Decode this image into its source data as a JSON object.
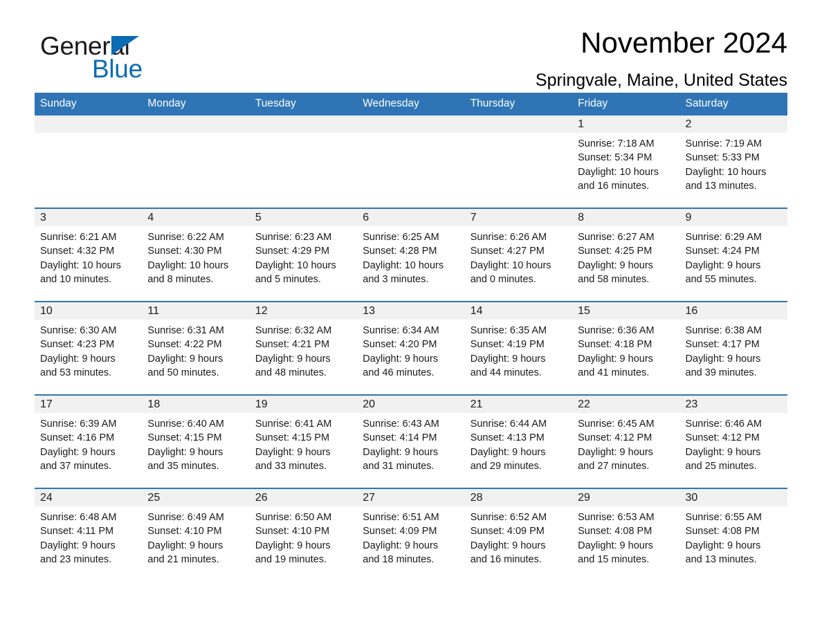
{
  "brand": {
    "name_part1": "General",
    "name_part2": "Blue",
    "flag_icon": "triangle-flag-icon",
    "accent_color": "#0b6cb4"
  },
  "header": {
    "month_title": "November 2024",
    "location": "Springvale, Maine, United States"
  },
  "calendar": {
    "header_color": "#2f75b5",
    "weekdays": [
      "Sunday",
      "Monday",
      "Tuesday",
      "Wednesday",
      "Thursday",
      "Friday",
      "Saturday"
    ],
    "weeks": [
      [
        {
          "day": "",
          "sunrise": "",
          "sunset": "",
          "daylight1": "",
          "daylight2": ""
        },
        {
          "day": "",
          "sunrise": "",
          "sunset": "",
          "daylight1": "",
          "daylight2": ""
        },
        {
          "day": "",
          "sunrise": "",
          "sunset": "",
          "daylight1": "",
          "daylight2": ""
        },
        {
          "day": "",
          "sunrise": "",
          "sunset": "",
          "daylight1": "",
          "daylight2": ""
        },
        {
          "day": "",
          "sunrise": "",
          "sunset": "",
          "daylight1": "",
          "daylight2": ""
        },
        {
          "day": "1",
          "sunrise": "Sunrise: 7:18 AM",
          "sunset": "Sunset: 5:34 PM",
          "daylight1": "Daylight: 10 hours",
          "daylight2": "and 16 minutes."
        },
        {
          "day": "2",
          "sunrise": "Sunrise: 7:19 AM",
          "sunset": "Sunset: 5:33 PM",
          "daylight1": "Daylight: 10 hours",
          "daylight2": "and 13 minutes."
        }
      ],
      [
        {
          "day": "3",
          "sunrise": "Sunrise: 6:21 AM",
          "sunset": "Sunset: 4:32 PM",
          "daylight1": "Daylight: 10 hours",
          "daylight2": "and 10 minutes."
        },
        {
          "day": "4",
          "sunrise": "Sunrise: 6:22 AM",
          "sunset": "Sunset: 4:30 PM",
          "daylight1": "Daylight: 10 hours",
          "daylight2": "and 8 minutes."
        },
        {
          "day": "5",
          "sunrise": "Sunrise: 6:23 AM",
          "sunset": "Sunset: 4:29 PM",
          "daylight1": "Daylight: 10 hours",
          "daylight2": "and 5 minutes."
        },
        {
          "day": "6",
          "sunrise": "Sunrise: 6:25 AM",
          "sunset": "Sunset: 4:28 PM",
          "daylight1": "Daylight: 10 hours",
          "daylight2": "and 3 minutes."
        },
        {
          "day": "7",
          "sunrise": "Sunrise: 6:26 AM",
          "sunset": "Sunset: 4:27 PM",
          "daylight1": "Daylight: 10 hours",
          "daylight2": "and 0 minutes."
        },
        {
          "day": "8",
          "sunrise": "Sunrise: 6:27 AM",
          "sunset": "Sunset: 4:25 PM",
          "daylight1": "Daylight: 9 hours",
          "daylight2": "and 58 minutes."
        },
        {
          "day": "9",
          "sunrise": "Sunrise: 6:29 AM",
          "sunset": "Sunset: 4:24 PM",
          "daylight1": "Daylight: 9 hours",
          "daylight2": "and 55 minutes."
        }
      ],
      [
        {
          "day": "10",
          "sunrise": "Sunrise: 6:30 AM",
          "sunset": "Sunset: 4:23 PM",
          "daylight1": "Daylight: 9 hours",
          "daylight2": "and 53 minutes."
        },
        {
          "day": "11",
          "sunrise": "Sunrise: 6:31 AM",
          "sunset": "Sunset: 4:22 PM",
          "daylight1": "Daylight: 9 hours",
          "daylight2": "and 50 minutes."
        },
        {
          "day": "12",
          "sunrise": "Sunrise: 6:32 AM",
          "sunset": "Sunset: 4:21 PM",
          "daylight1": "Daylight: 9 hours",
          "daylight2": "and 48 minutes."
        },
        {
          "day": "13",
          "sunrise": "Sunrise: 6:34 AM",
          "sunset": "Sunset: 4:20 PM",
          "daylight1": "Daylight: 9 hours",
          "daylight2": "and 46 minutes."
        },
        {
          "day": "14",
          "sunrise": "Sunrise: 6:35 AM",
          "sunset": "Sunset: 4:19 PM",
          "daylight1": "Daylight: 9 hours",
          "daylight2": "and 44 minutes."
        },
        {
          "day": "15",
          "sunrise": "Sunrise: 6:36 AM",
          "sunset": "Sunset: 4:18 PM",
          "daylight1": "Daylight: 9 hours",
          "daylight2": "and 41 minutes."
        },
        {
          "day": "16",
          "sunrise": "Sunrise: 6:38 AM",
          "sunset": "Sunset: 4:17 PM",
          "daylight1": "Daylight: 9 hours",
          "daylight2": "and 39 minutes."
        }
      ],
      [
        {
          "day": "17",
          "sunrise": "Sunrise: 6:39 AM",
          "sunset": "Sunset: 4:16 PM",
          "daylight1": "Daylight: 9 hours",
          "daylight2": "and 37 minutes."
        },
        {
          "day": "18",
          "sunrise": "Sunrise: 6:40 AM",
          "sunset": "Sunset: 4:15 PM",
          "daylight1": "Daylight: 9 hours",
          "daylight2": "and 35 minutes."
        },
        {
          "day": "19",
          "sunrise": "Sunrise: 6:41 AM",
          "sunset": "Sunset: 4:15 PM",
          "daylight1": "Daylight: 9 hours",
          "daylight2": "and 33 minutes."
        },
        {
          "day": "20",
          "sunrise": "Sunrise: 6:43 AM",
          "sunset": "Sunset: 4:14 PM",
          "daylight1": "Daylight: 9 hours",
          "daylight2": "and 31 minutes."
        },
        {
          "day": "21",
          "sunrise": "Sunrise: 6:44 AM",
          "sunset": "Sunset: 4:13 PM",
          "daylight1": "Daylight: 9 hours",
          "daylight2": "and 29 minutes."
        },
        {
          "day": "22",
          "sunrise": "Sunrise: 6:45 AM",
          "sunset": "Sunset: 4:12 PM",
          "daylight1": "Daylight: 9 hours",
          "daylight2": "and 27 minutes."
        },
        {
          "day": "23",
          "sunrise": "Sunrise: 6:46 AM",
          "sunset": "Sunset: 4:12 PM",
          "daylight1": "Daylight: 9 hours",
          "daylight2": "and 25 minutes."
        }
      ],
      [
        {
          "day": "24",
          "sunrise": "Sunrise: 6:48 AM",
          "sunset": "Sunset: 4:11 PM",
          "daylight1": "Daylight: 9 hours",
          "daylight2": "and 23 minutes."
        },
        {
          "day": "25",
          "sunrise": "Sunrise: 6:49 AM",
          "sunset": "Sunset: 4:10 PM",
          "daylight1": "Daylight: 9 hours",
          "daylight2": "and 21 minutes."
        },
        {
          "day": "26",
          "sunrise": "Sunrise: 6:50 AM",
          "sunset": "Sunset: 4:10 PM",
          "daylight1": "Daylight: 9 hours",
          "daylight2": "and 19 minutes."
        },
        {
          "day": "27",
          "sunrise": "Sunrise: 6:51 AM",
          "sunset": "Sunset: 4:09 PM",
          "daylight1": "Daylight: 9 hours",
          "daylight2": "and 18 minutes."
        },
        {
          "day": "28",
          "sunrise": "Sunrise: 6:52 AM",
          "sunset": "Sunset: 4:09 PM",
          "daylight1": "Daylight: 9 hours",
          "daylight2": "and 16 minutes."
        },
        {
          "day": "29",
          "sunrise": "Sunrise: 6:53 AM",
          "sunset": "Sunset: 4:08 PM",
          "daylight1": "Daylight: 9 hours",
          "daylight2": "and 15 minutes."
        },
        {
          "day": "30",
          "sunrise": "Sunrise: 6:55 AM",
          "sunset": "Sunset: 4:08 PM",
          "daylight1": "Daylight: 9 hours",
          "daylight2": "and 13 minutes."
        }
      ]
    ]
  }
}
